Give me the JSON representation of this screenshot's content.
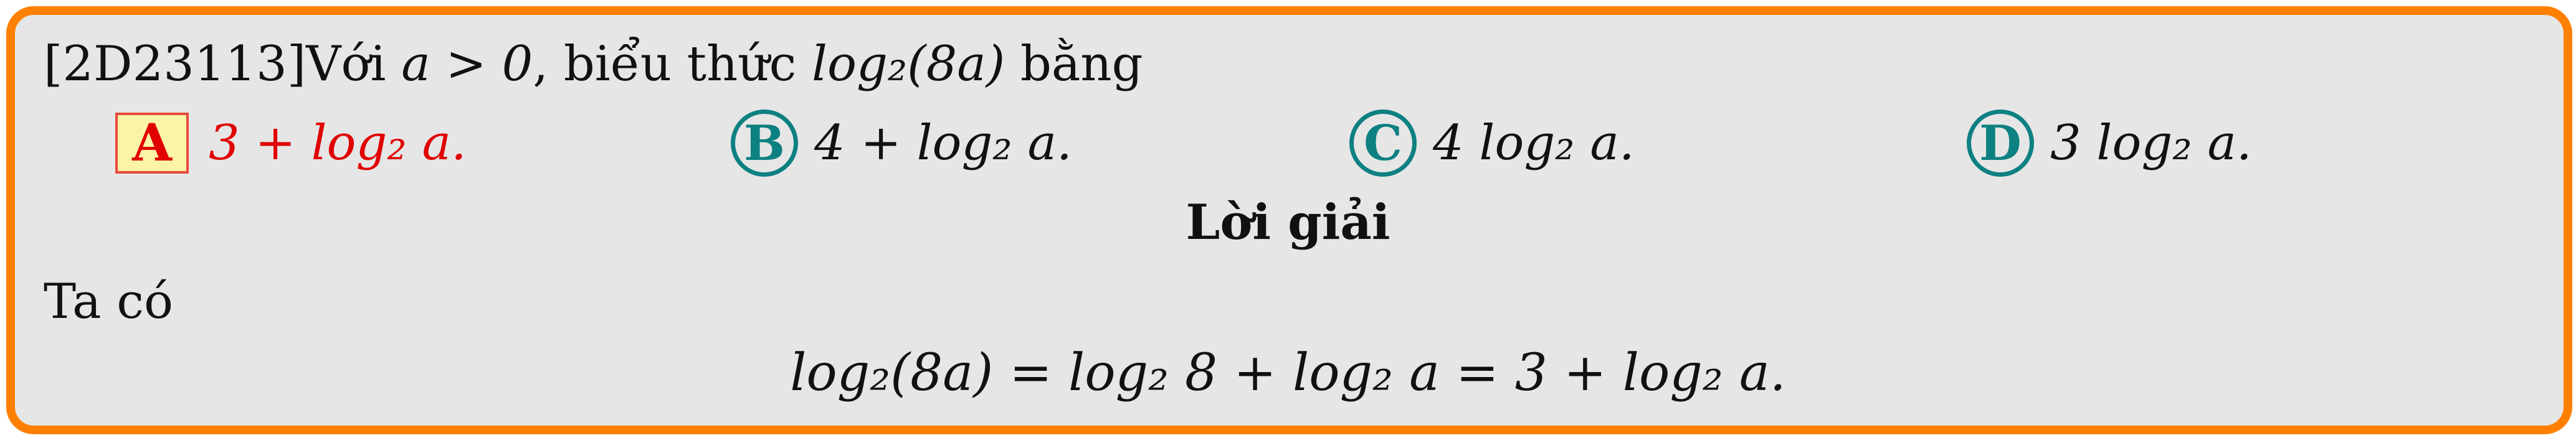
{
  "problem": {
    "code": "[2D23113]",
    "prefix": "Với ",
    "condition": "a > 0",
    "middle": ", biểu thức ",
    "expression": "log₂(8a)",
    "suffix": " bằng"
  },
  "options": [
    {
      "letter": "A",
      "text": "3 + log₂ a.",
      "correct": true
    },
    {
      "letter": "B",
      "text": "4 + log₂ a.",
      "correct": false
    },
    {
      "letter": "C",
      "text": "4 log₂ a.",
      "correct": false
    },
    {
      "letter": "D",
      "text": "3 log₂ a.",
      "correct": false
    }
  ],
  "solution": {
    "heading": "Lời giải",
    "intro": "Ta có",
    "equation": "log₂(8a) = log₂ 8 + log₂ a = 3 + log₂ a."
  },
  "colors": {
    "frame": "#ff8000",
    "background": "#e6e6e6",
    "correct": "#e00000",
    "option_circle": "#0d8082",
    "answer_box_fill": "#fbf3a6"
  }
}
